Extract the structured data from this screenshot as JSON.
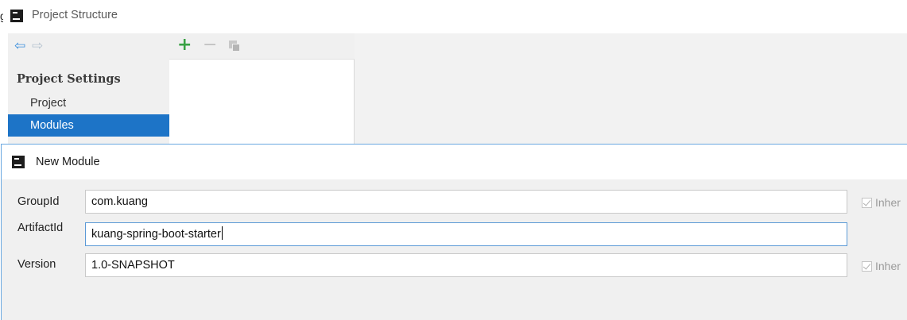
{
  "project_structure": {
    "title": "Project Structure",
    "title_clipped_char": "g",
    "nav": {
      "back_icon": "arrow-left-icon",
      "forward_icon": "arrow-right-icon"
    },
    "sidebar": {
      "section_header": "Project Settings",
      "items": [
        "Project",
        "Modules"
      ],
      "selected": "Modules"
    },
    "toolbar": {
      "add_icon": "plus-icon",
      "remove_icon": "minus-icon",
      "copy_icon": "copy-icon"
    },
    "colors": {
      "selection": "#1d74c7",
      "add": "#39a144"
    }
  },
  "new_module": {
    "title": "New Module",
    "fields": {
      "group_id": {
        "label": "GroupId",
        "value": "com.kuang"
      },
      "artifact_id": {
        "label": "ArtifactId",
        "value": "kuang-spring-boot-starter"
      },
      "version": {
        "label": "Version",
        "value": "1.0-SNAPSHOT"
      }
    },
    "inherit_label": "Inher",
    "focused_field": "artifact_id"
  }
}
